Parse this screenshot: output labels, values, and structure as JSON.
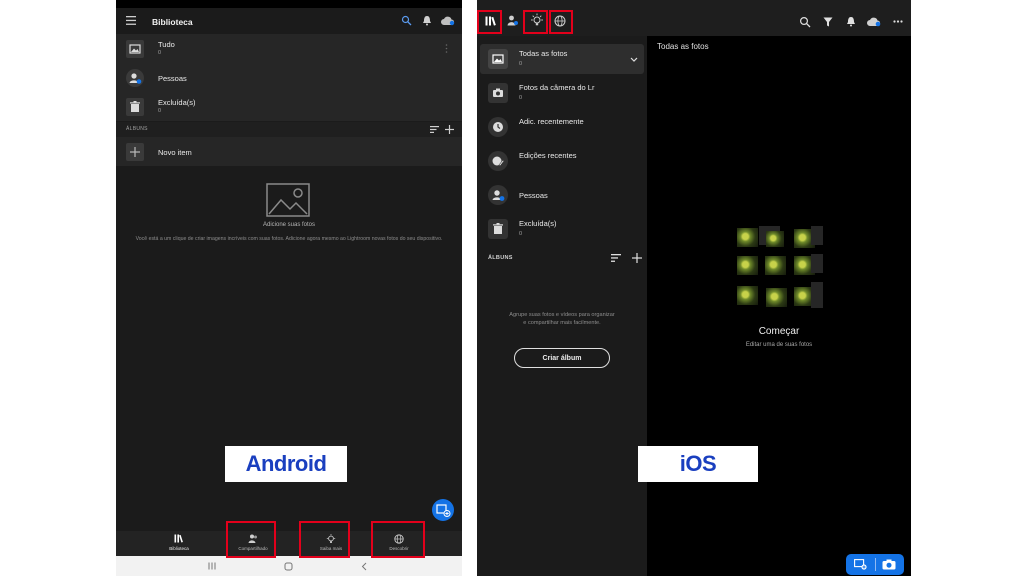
{
  "android": {
    "app_title": "Biblioteca",
    "library_items": [
      {
        "label": "Tudo",
        "count": "0"
      },
      {
        "label": "Pessoas",
        "count": ""
      },
      {
        "label": "Excluída(s)",
        "count": "0"
      }
    ],
    "albums_label": "ÁLBUNS",
    "new_item_label": "Novo item",
    "empty_title": "Adicione suas fotos",
    "empty_description": "Você está a um clique de criar imagens incríveis com suas fotos. Adicione agora mesmo ao Lightroom novas fotos do seu dispositivo.",
    "bottom_tabs": [
      {
        "label": "Biblioteca",
        "icon": "library-icon"
      },
      {
        "label": "Compartilhado",
        "icon": "shared-people-icon"
      },
      {
        "label": "Saiba mais",
        "icon": "lightbulb-icon"
      },
      {
        "label": "Descobrir",
        "icon": "globe-icon"
      }
    ],
    "platform_tag": "Android"
  },
  "ios": {
    "top_icons": [
      "library-icon",
      "shared-people-icon",
      "lightbulb-icon",
      "globe-icon"
    ],
    "right_icons": [
      "search-people-icon",
      "filter-icon",
      "bell-icon",
      "cloud-sync-icon",
      "more-icon"
    ],
    "sidebar_items": [
      {
        "label": "Todas as fotos",
        "count": "0"
      },
      {
        "label": "Fotos da câmera do Lr",
        "count": "0"
      },
      {
        "label": "Adic. recentemente",
        "count": ""
      },
      {
        "label": "Edições recentes",
        "count": ""
      },
      {
        "label": "Pessoas",
        "count": ""
      },
      {
        "label": "Excluída(s)",
        "count": "0"
      }
    ],
    "albums_label": "ÁLBUNS",
    "group_text": "Agrupe suas fotos e vídeos para organizar e compartilhar mais facilmente.",
    "create_album_label": "Criar álbum",
    "main_title": "Todas as fotos",
    "start_title": "Começar",
    "start_subtitle": "Editar uma de suas fotos",
    "platform_tag": "iOS"
  },
  "colors": {
    "highlight": "#e3001b",
    "accent_blue": "#1473e6",
    "tag_text": "#1a3fbf"
  }
}
